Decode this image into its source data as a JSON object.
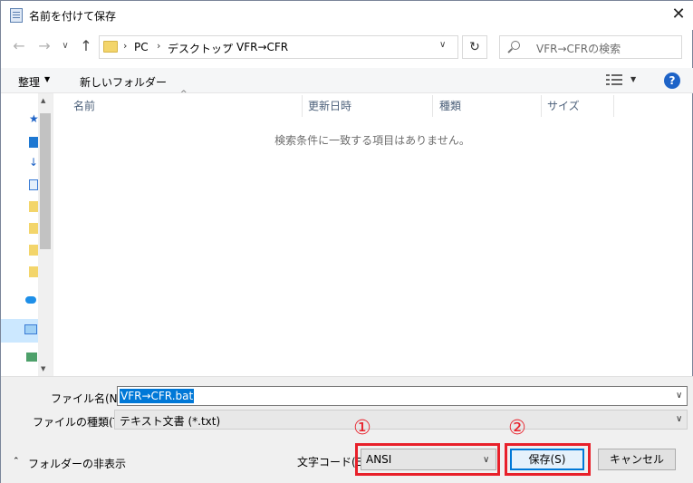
{
  "window": {
    "title": "名前を付けて保存"
  },
  "address": {
    "crumbs": [
      "PC",
      "デスクトップ",
      "VFR→CFR"
    ]
  },
  "search": {
    "placeholder": "VFR→CFRの検索"
  },
  "toolbar": {
    "organize": "整理",
    "new_folder": "新しいフォルダー"
  },
  "columns": [
    "名前",
    "更新日時",
    "種類",
    "サイズ"
  ],
  "list": {
    "empty_message": "検索条件に一致する項目はありません。"
  },
  "form": {
    "filename_label": "ファイル名(N):",
    "filename_value": "VFR→CFR.bat",
    "filetype_label": "ファイルの種類(T):",
    "filetype_value": "テキスト文書 (*.txt)",
    "encoding_label": "文字コード(E):",
    "encoding_value": "ANSI",
    "hide_folders": "フォルダーの非表示",
    "save_label": "保存(S)",
    "cancel_label": "キャンセル"
  },
  "annotations": {
    "step1": "①",
    "step2": "②",
    "color": "#e8202a"
  },
  "colors": {
    "accent": "#0078d7",
    "help": "#1e63c7",
    "folder": "#f3d56b"
  },
  "icons": [
    "document-icon",
    "close-icon",
    "back-arrow-icon",
    "forward-arrow-icon",
    "up-arrow-icon",
    "folder-icon",
    "refresh-icon",
    "search-icon",
    "view-options-icon",
    "help-icon"
  ]
}
